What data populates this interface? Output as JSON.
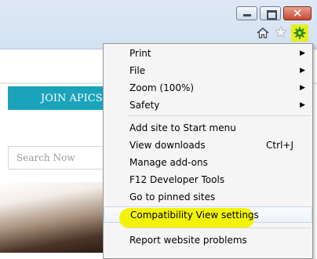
{
  "page": {
    "join_label": "JOIN APICS",
    "search_placeholder": "Search Now"
  },
  "toolbar": {
    "icons": [
      "home-icon",
      "favorites-star-icon",
      "tools-gear-icon"
    ],
    "gear_highlight_color": "#e6ee22"
  },
  "menu": {
    "print": "Print",
    "file": "File",
    "zoom": "Zoom (100%)",
    "safety": "Safety",
    "add_site": "Add site to Start menu",
    "view_downloads": "View downloads",
    "view_downloads_shortcut": "Ctrl+J",
    "manage_addons": "Manage add-ons",
    "f12_tools": "F12 Developer Tools",
    "pinned_sites": "Go to pinned sites",
    "compat_view": "Compatibility View settings",
    "report_problems": "Report website problems",
    "highlight_color": "#f3f30a"
  }
}
